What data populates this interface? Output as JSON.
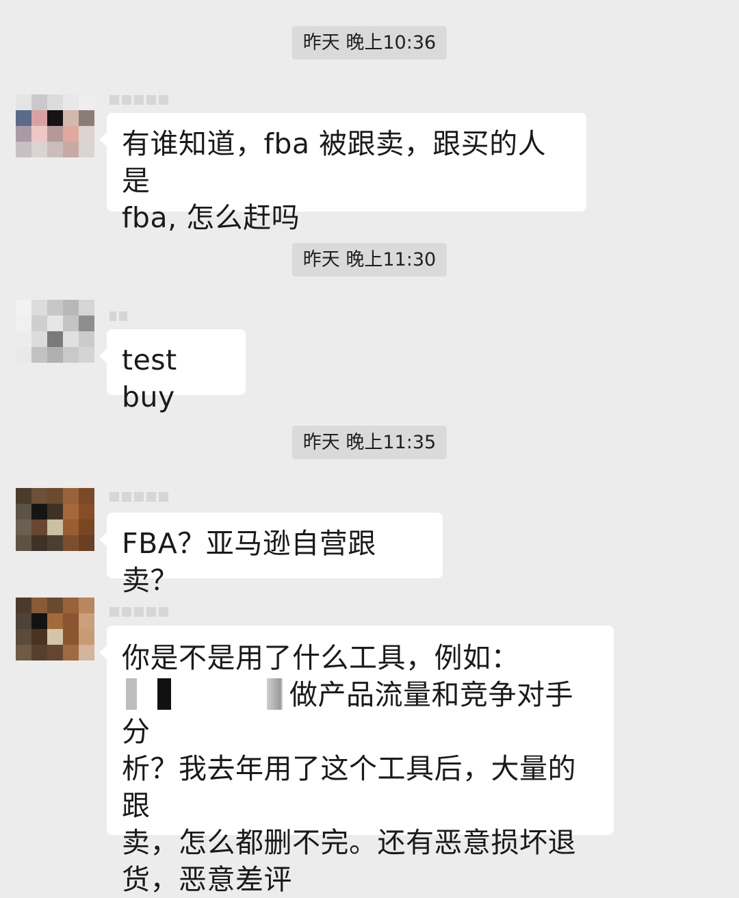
{
  "messages": [
    {
      "timestamp": "昨天 晚上10:36",
      "text_lines": [
        "有谁知道，fba 被跟卖，跟买的人是",
        "fba, 怎么赶吗"
      ]
    },
    {
      "timestamp": "昨天 晚上11:30",
      "text_lines": [
        "test buy"
      ]
    },
    {
      "timestamp": "昨天 晚上11:35",
      "text_lines": [
        "FBA？亚马逊自营跟卖？"
      ]
    },
    {
      "text_lines": [
        "你是不是用了什么工具，例如：",
        "做产品流量和竞争对手分",
        "析？我去年用了这个工具后，大量的跟",
        "卖，怎么都删不完。还有恶意损坏退",
        "货，恶意差评"
      ]
    }
  ],
  "colors": {
    "background": "#ececec",
    "bubble": "#ffffff",
    "timestamp_bg": "#dadada"
  }
}
